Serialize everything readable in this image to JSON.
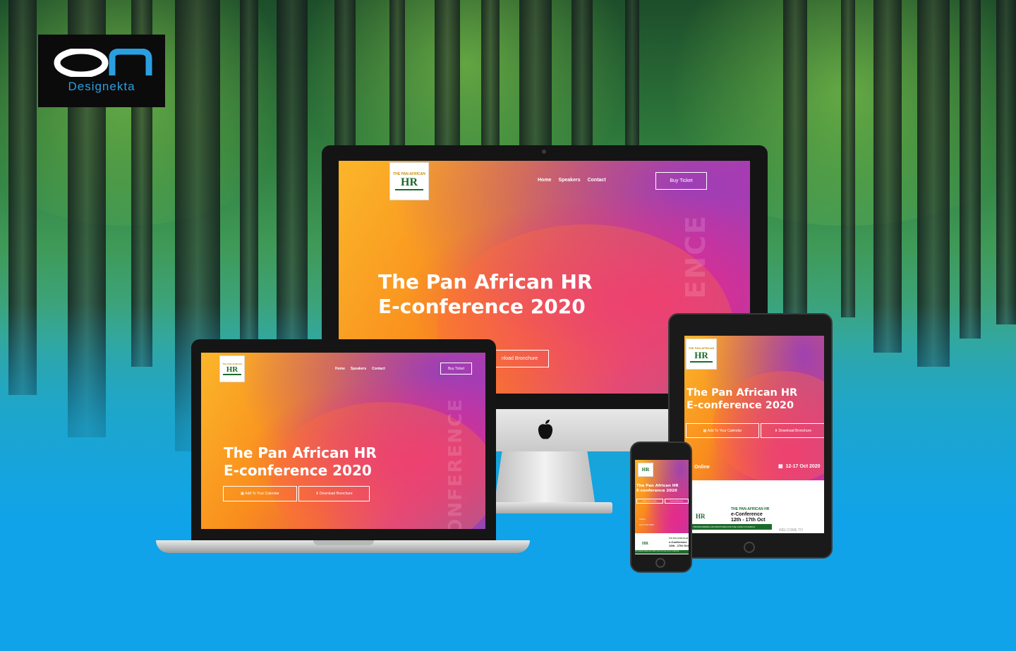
{
  "brand": {
    "name": "Designekta"
  },
  "site": {
    "logo_top": "THE PAN-AFRICAN",
    "logo_mid": "HR",
    "nav": [
      "Home",
      "Speakers",
      "Contact"
    ],
    "buy_ticket": "Buy Ticket",
    "headline_line1": "The Pan African HR",
    "headline_line2": "E-conference 2020",
    "calendar_btn": "Add To Your Calendar",
    "brochure_btn": "Download Bronchure",
    "brochure_btn_partial": "nload Bronchure",
    "vertical_word": "CONFERENCE",
    "vertical_word_partial": "ENCE",
    "vertical_word_laptop": "ONFERENCE",
    "location": "Online",
    "dates": "12-17 Oct 2020",
    "banner_title1": "THE PAN-AFRICAN HR",
    "banner_title2": "e-Conference",
    "banner_dates": "12th - 17th Oct",
    "banner_strip": "HR TRANSFORMING HR PRACTICES FOR THE GOOD OF AFRICA",
    "welcome": "WELCOME TO"
  },
  "colors": {
    "brand_blue": "#2a9fe0",
    "site_orange": "#f98d1d",
    "site_pink": "#d43b95",
    "site_purple": "#8a48b8",
    "hr_green": "#1c6b2a",
    "background_blue": "#10a3ea"
  }
}
